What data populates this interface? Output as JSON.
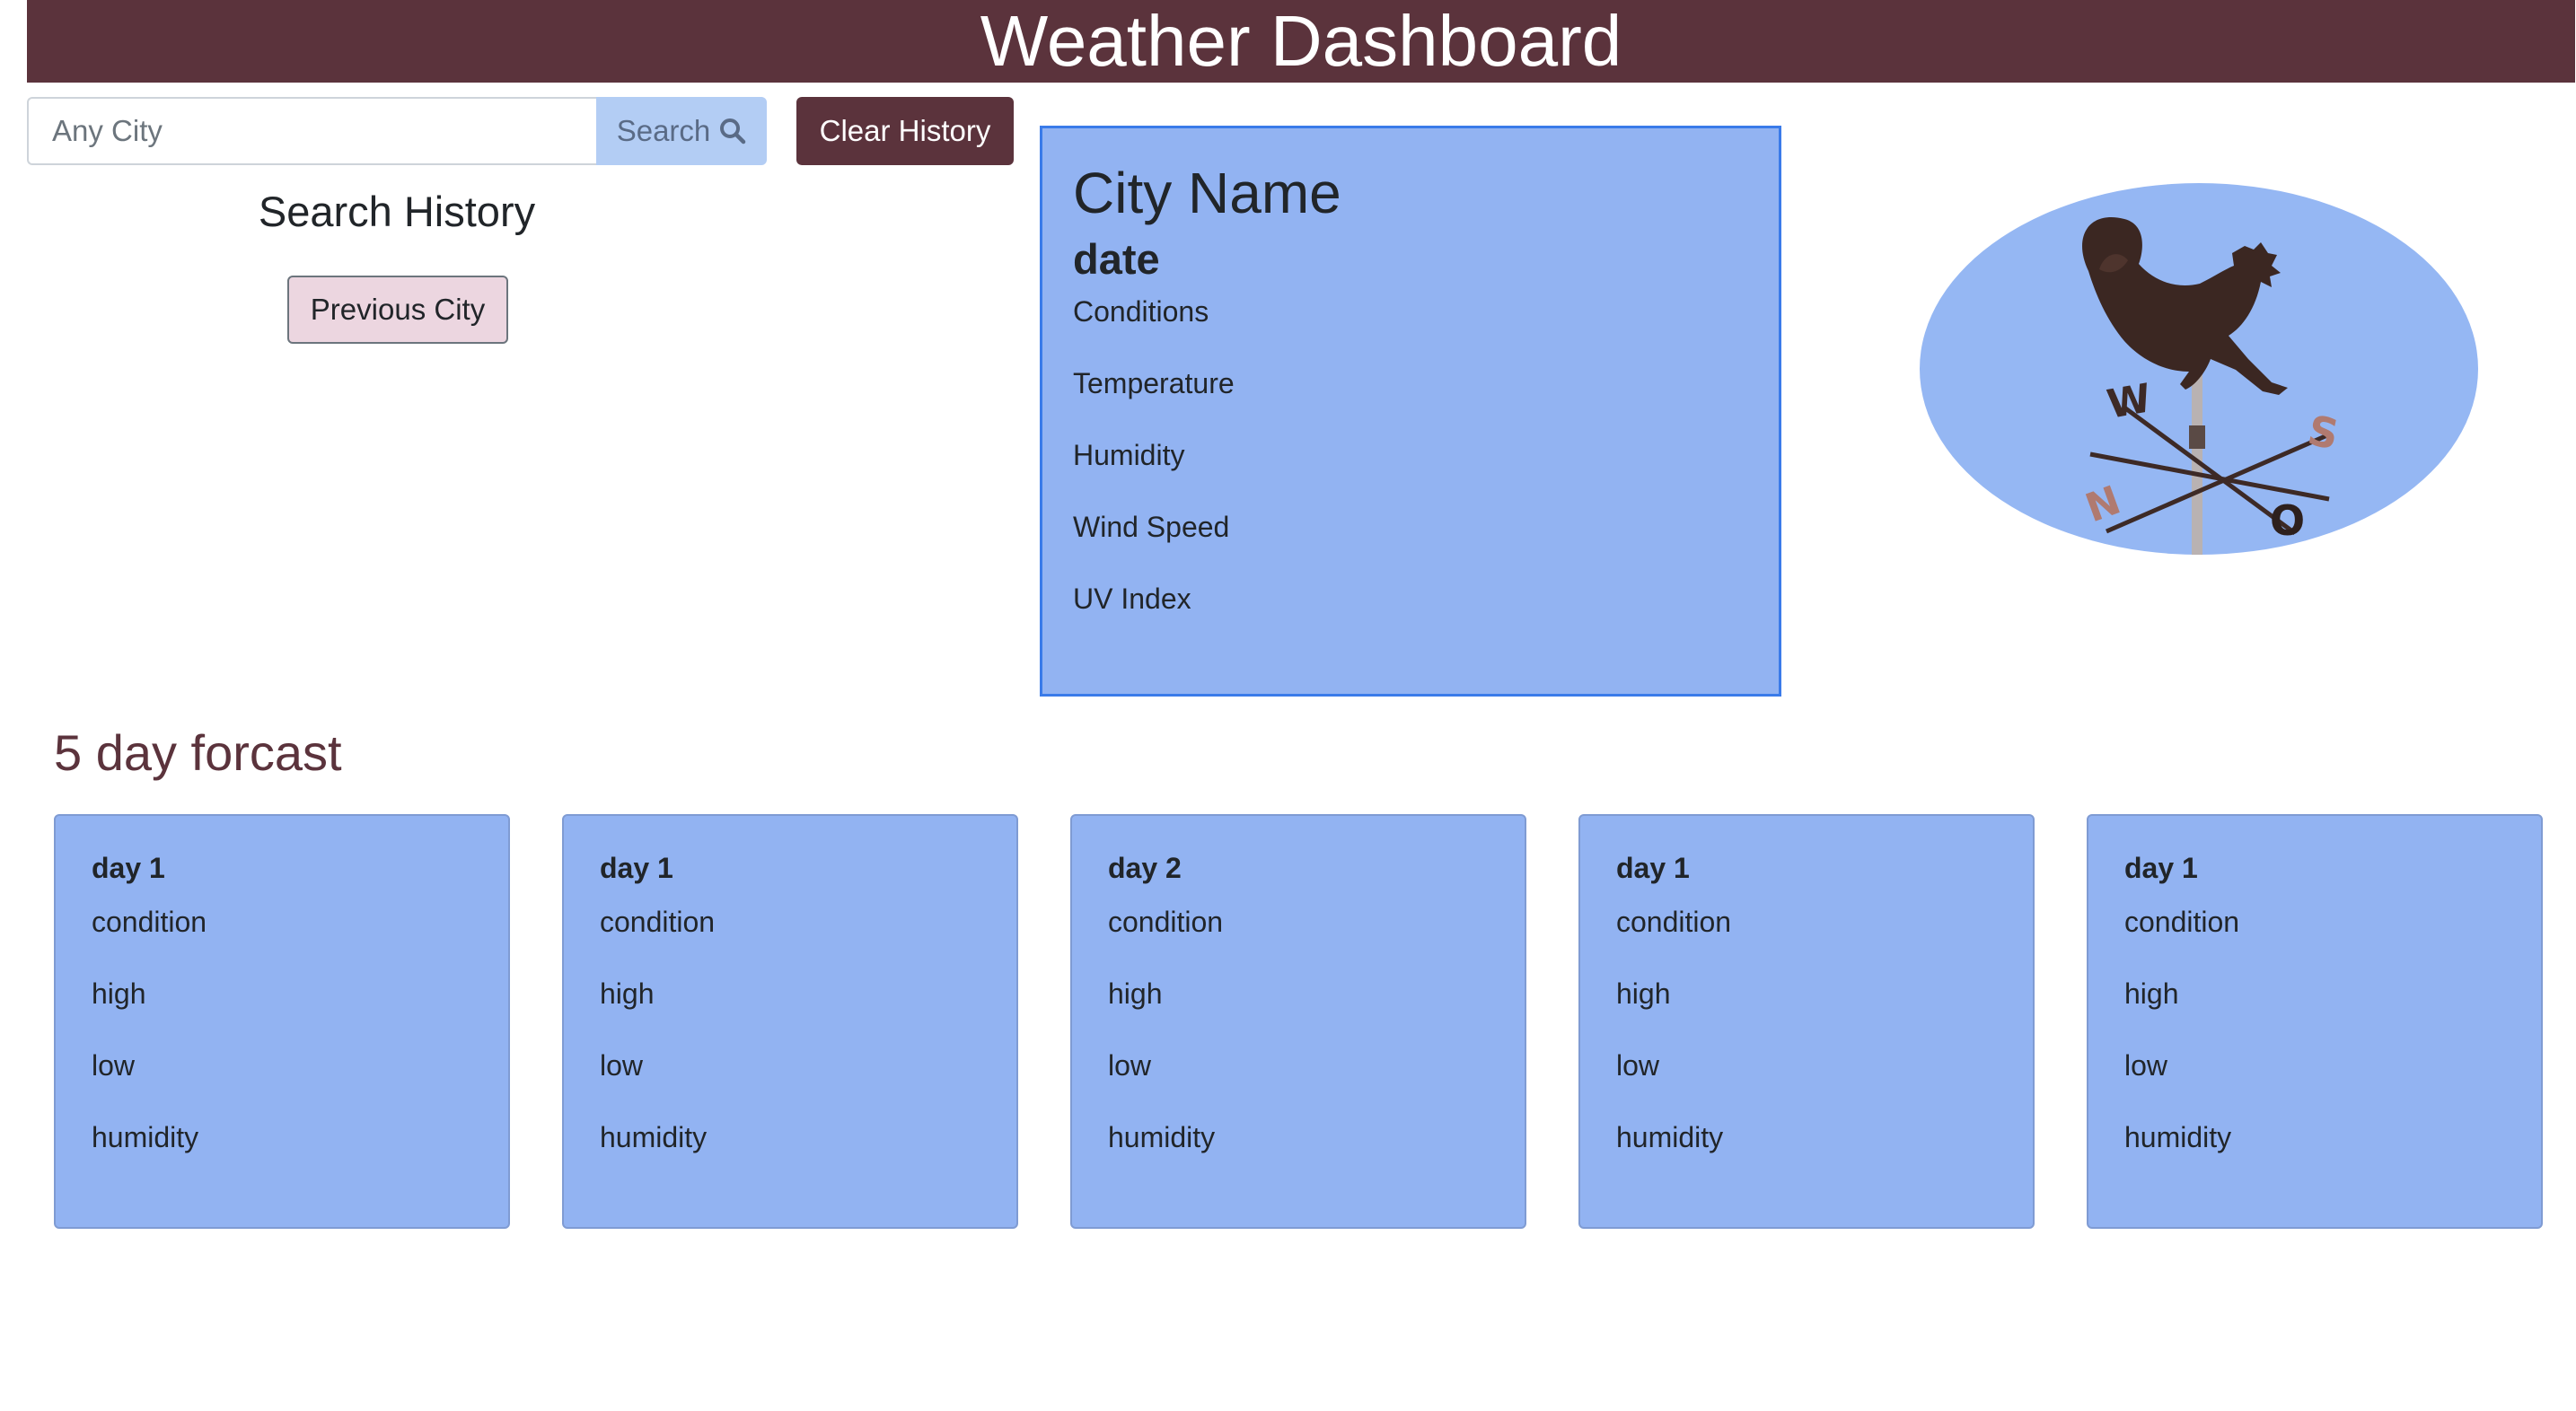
{
  "header": {
    "title": "Weather Dashboard"
  },
  "search": {
    "placeholder": "Any City",
    "button_label": "Search",
    "clear_label": "Clear History"
  },
  "history": {
    "title": "Search History",
    "items": [
      {
        "label": "Previous City"
      }
    ]
  },
  "current": {
    "city": "City Name",
    "date": "date",
    "fields": [
      "Conditions",
      "Temperature",
      "Humidity",
      "Wind Speed",
      "UV Index"
    ]
  },
  "forecast": {
    "title": "5 day forcast",
    "days": [
      {
        "day": "day 1",
        "condition": "condition",
        "high": "high",
        "low": "low",
        "humidity": "humidity"
      },
      {
        "day": "day 1",
        "condition": "condition",
        "high": "high",
        "low": "low",
        "humidity": "humidity"
      },
      {
        "day": "day 2",
        "condition": "condition",
        "high": "high",
        "low": "low",
        "humidity": "humidity"
      },
      {
        "day": "day 1",
        "condition": "condition",
        "high": "high",
        "low": "low",
        "humidity": "humidity"
      },
      {
        "day": "day 1",
        "condition": "condition",
        "high": "high",
        "low": "low",
        "humidity": "humidity"
      }
    ]
  },
  "icons": {
    "search": "search-icon",
    "weather_vane": "rooster-weather-vane-image"
  },
  "colors": {
    "brand": "#5b333c",
    "card": "#92b3f2",
    "card_border": "#3a7be9",
    "history_button": "#ecd6e0"
  }
}
